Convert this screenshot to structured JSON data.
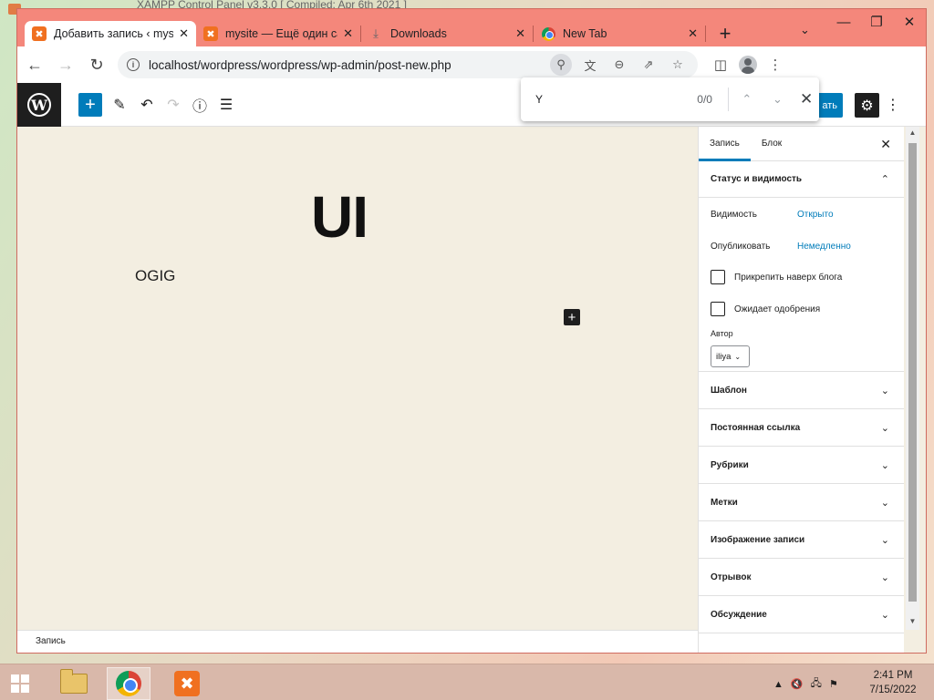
{
  "desktop": {
    "background_title": "XAMPP Control Panel v3.3.0  [ Compiled: Apr 6th 2021 ]"
  },
  "browser": {
    "tabs": [
      {
        "title": "Добавить запись ‹ mysite",
        "icon": "xampp-icon",
        "active": true
      },
      {
        "title": "mysite — Ещё один сайт",
        "icon": "xampp-icon",
        "active": false
      },
      {
        "title": "Downloads",
        "icon": "download-icon",
        "active": false
      },
      {
        "title": "New Tab",
        "icon": "chrome-icon",
        "active": false
      }
    ],
    "new_tab_symbol": "+",
    "tab_search_symbol": "⌄",
    "url": "localhost/wordpress/wordpress/wp-admin/post-new.php",
    "accent_color": "#f4877b"
  },
  "find_bar": {
    "query": "Y",
    "count": "0/0"
  },
  "editor": {
    "publish_label": "ать",
    "post_title": "UI",
    "paragraph": "OGIG",
    "footer_breadcrumb": "Запись",
    "accent_color": "#007cba"
  },
  "sidebar": {
    "tabs": [
      "Запись",
      "Блок"
    ],
    "status_panel": {
      "title": "Статус и видимость",
      "visibility_label": "Видимость",
      "visibility_value": "Открыто",
      "publish_label": "Опубликовать",
      "publish_value": "Немедленно",
      "sticky_label": "Прикрепить наверх блога",
      "pending_label": "Ожидает одобрения",
      "author_label": "Автор",
      "author_value": "iliya"
    },
    "panels": [
      "Шаблон",
      "Постоянная ссылка",
      "Рубрики",
      "Метки",
      "Изображение записи",
      "Отрывок",
      "Обсуждение"
    ]
  },
  "taskbar": {
    "time": "2:41 PM",
    "date": "7/15/2022"
  }
}
